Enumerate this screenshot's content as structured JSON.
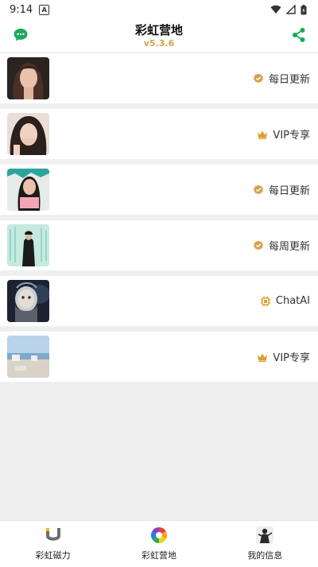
{
  "status_bar": {
    "time": "9:14",
    "notif_letter": "A"
  },
  "header": {
    "title": "彩虹营地",
    "version": "v5.3.6"
  },
  "list": {
    "items": [
      {
        "tag": "每日更新",
        "tag_icon": "verified-badge-icon"
      },
      {
        "tag": "VIP专享",
        "tag_icon": "crown-icon"
      },
      {
        "tag": "每日更新",
        "tag_icon": "verified-badge-icon"
      },
      {
        "tag": "每周更新",
        "tag_icon": "verified-badge-icon"
      },
      {
        "tag": "ChatAI",
        "tag_icon": "chip-icon"
      },
      {
        "tag": "VIP专享",
        "tag_icon": "crown-icon"
      }
    ]
  },
  "bottom_nav": {
    "items": [
      {
        "label": "彩虹磁力"
      },
      {
        "label": "彩虹营地"
      },
      {
        "label": "我的信息"
      }
    ]
  },
  "colors": {
    "accent_green": "#1aaa5a",
    "gold": "#d4a24a",
    "crown": "#d9a032"
  }
}
